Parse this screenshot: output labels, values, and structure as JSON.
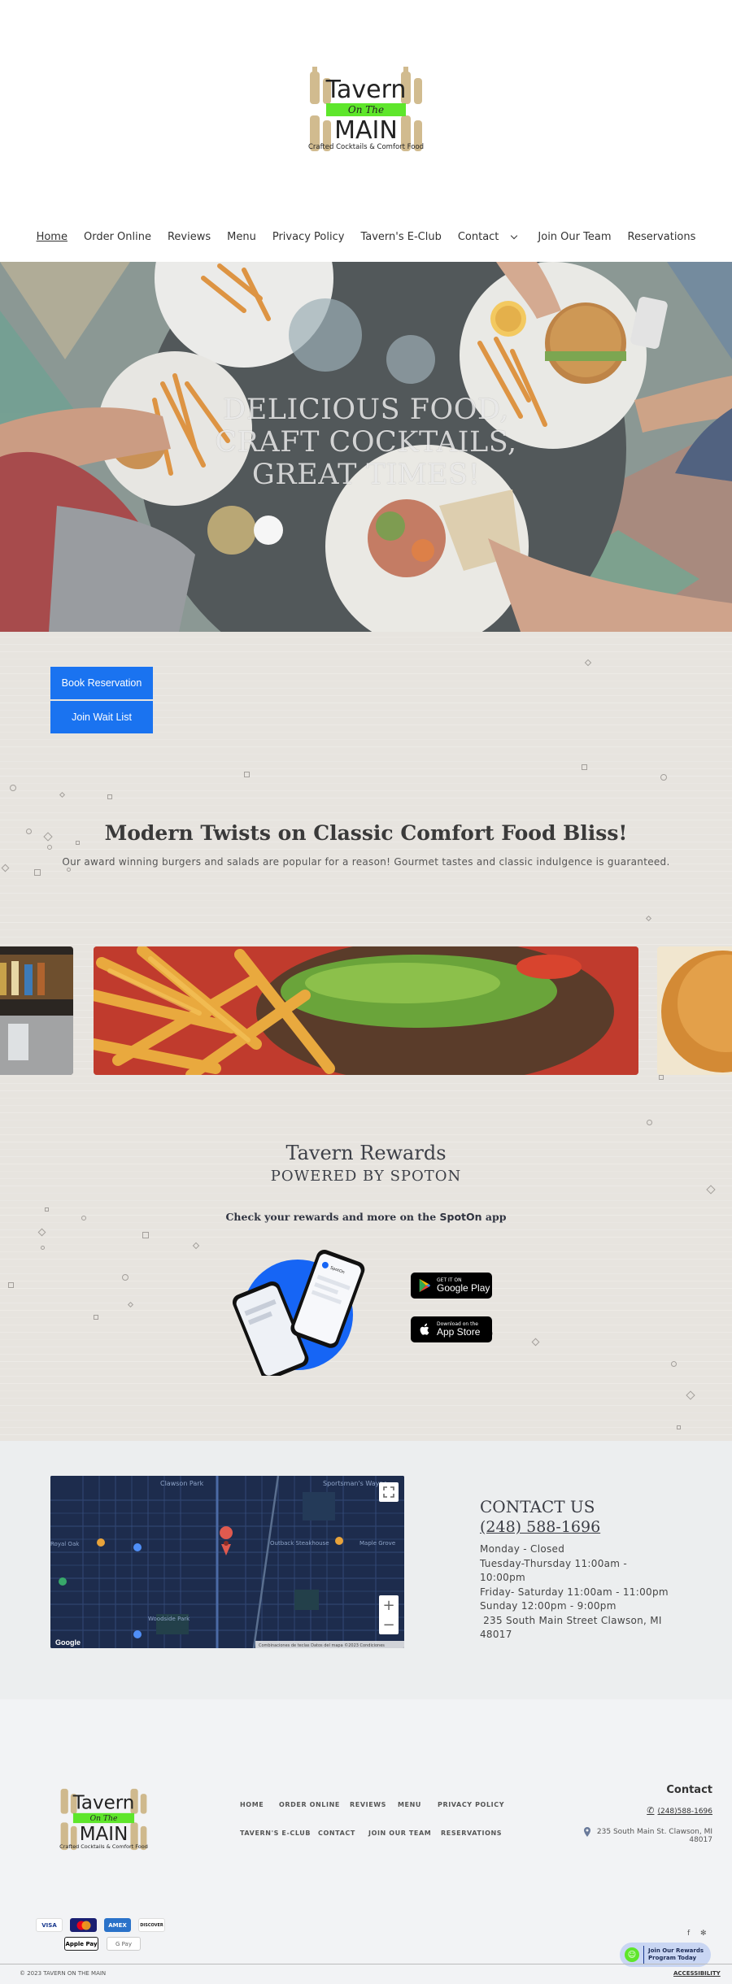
{
  "header": {
    "logo": {
      "line1": "Tavern",
      "line2": "On The",
      "line3": "MAIN",
      "line4": "Crafted Cocktails & Comfort Food"
    },
    "nav": [
      {
        "label": "Home"
      },
      {
        "label": "Order Online"
      },
      {
        "label": "Reviews"
      },
      {
        "label": "Menu"
      },
      {
        "label": "Privacy Policy"
      },
      {
        "label": "Tavern's E-Club"
      },
      {
        "label": "Contact"
      },
      {
        "label": "Join Our Team"
      },
      {
        "label": "Reservations"
      }
    ]
  },
  "hero": {
    "title": "DELICIOUS FOOD,\nCRAFT COCKTAILS,\nGREAT TIMES!"
  },
  "actions": {
    "book": "Book Reservation",
    "waitlist": "Join Wait List"
  },
  "tagline": {
    "heading": "Modern Twists on Classic Comfort Food Bliss!",
    "text": "Our award winning burgers and salads are popular for a reason! Gourmet tastes and classic indulgence is guaranteed."
  },
  "rewards": {
    "title": "Tavern Rewards",
    "subtitle": "POWERED BY SPOTON",
    "check_prefix": "Check your rewards and more on the ",
    "check_brand": "SpotOn",
    "check_suffix": " app",
    "phone_brand": "SpotOn",
    "google_top": "GET IT ON",
    "google_name": "Google Play",
    "apple_top": "Download on the",
    "apple_name": "App Store"
  },
  "map": {
    "labels": {
      "a": "Clawson Park",
      "b": "Sportsman's Wayne",
      "c": "Royal Oak",
      "d": "Outback Steakhouse",
      "e": "Maple Grove",
      "f": "Woodside Park",
      "g": "Google"
    },
    "attribution": "Combinaciones de teclas   Datos del mapa ©2023   Condiciones"
  },
  "contact": {
    "heading": "CONTACT US",
    "phone": "(248) 588-1696",
    "hours": [
      "Monday - Closed",
      "Tuesday-Thursday 11:00am - 10:00pm",
      "Friday- Saturday 11:00am - 11:00pm",
      "Sunday 12:00pm - 9:00pm",
      " 235 South Main Street Clawson, MI",
      "48017"
    ]
  },
  "footer": {
    "nav_row1": [
      "HOME",
      "ORDER ONLINE",
      "REVIEWS",
      "MENU",
      "PRIVACY POLICY"
    ],
    "nav_row2": [
      "TAVERN'S E-CLUB",
      "CONTACT",
      "JOIN OUR TEAM",
      "RESERVATIONS"
    ],
    "contact_heading": "Contact",
    "phone": "(248)588-1696",
    "address": "235 South Main St. Clawson, MI 48017",
    "payments": [
      "VISA",
      "MC",
      "AMEX",
      "DISCOVER",
      "Apple Pay",
      "G Pay"
    ],
    "rewards_pill": "Join Our Rewards Program Today",
    "copyright": "© 2023 TAVERN ON THE MAIN",
    "accessibility": "ACCESSIBILITY"
  },
  "colors": {
    "accent": "#1a73f0",
    "logo_green": "#5ee62b"
  }
}
